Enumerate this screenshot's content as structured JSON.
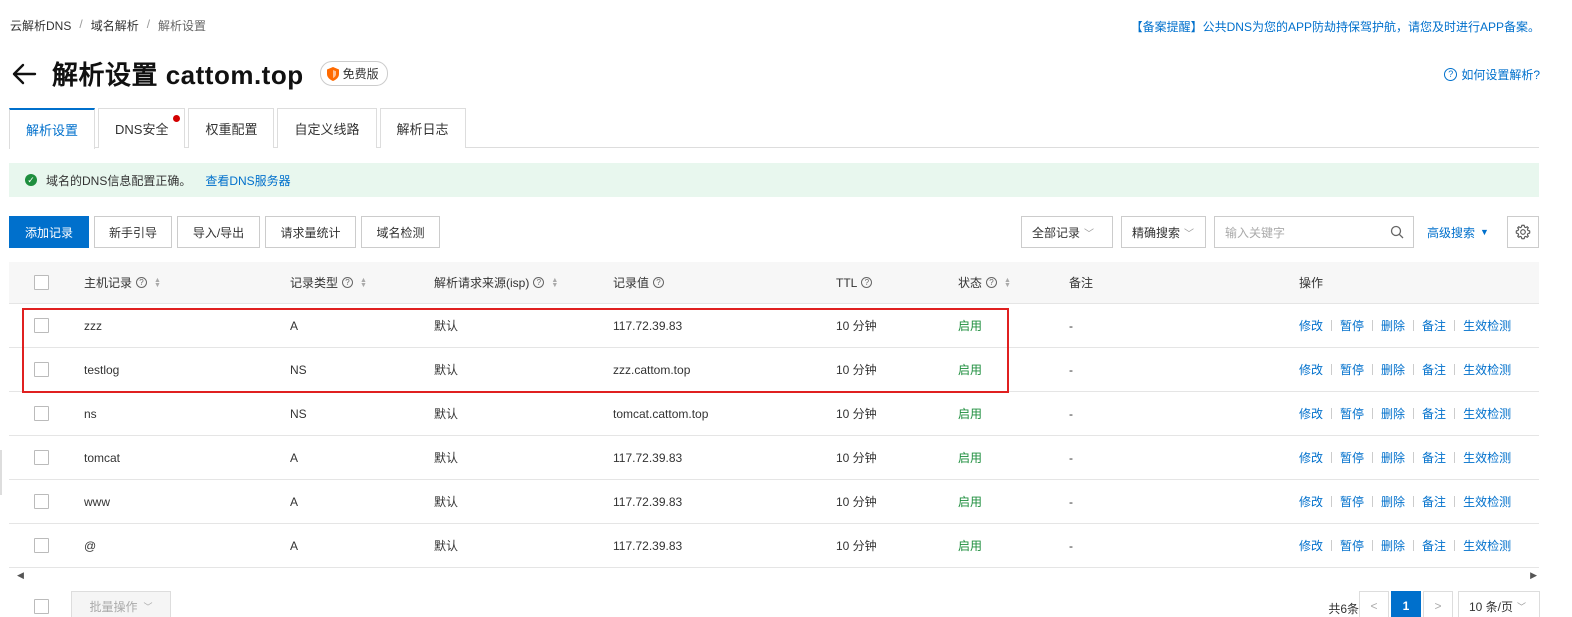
{
  "breadcrumb": [
    "云解析DNS",
    "域名解析",
    "解析设置"
  ],
  "breadcrumb_sep": "/",
  "notice": "【备案提醒】公共DNS为您的APP防劫持保驾护航，请您及时进行APP备案。",
  "header": {
    "title": "解析设置 cattom.top",
    "plan_badge": "免费版",
    "help_link": "如何设置解析?",
    "help_icon_text": "?"
  },
  "tabs": [
    {
      "label": "解析设置",
      "active": true
    },
    {
      "label": "DNS安全",
      "active": false,
      "has_dot": true
    },
    {
      "label": "权重配置",
      "active": false
    },
    {
      "label": "自定义线路",
      "active": false
    },
    {
      "label": "解析日志",
      "active": false
    }
  ],
  "alert": {
    "message": "域名的DNS信息配置正确。",
    "link": "查看DNS服务器",
    "icon_glyph": "✓"
  },
  "toolbar": {
    "add": "添加记录",
    "guide": "新手引导",
    "import_export": "导入/导出",
    "stats": "请求量统计",
    "check": "域名检测",
    "filter_all": "全部记录",
    "search_mode": "精确搜索",
    "search_placeholder": "输入关键字",
    "advanced": "高级搜索"
  },
  "table": {
    "columns": [
      "主机记录",
      "记录类型",
      "解析请求来源(isp)",
      "记录值",
      "TTL",
      "状态",
      "备注",
      "操作"
    ],
    "rows": [
      {
        "host": "zzz",
        "type": "A",
        "isp": "默认",
        "value": "117.72.39.83",
        "ttl": "10 分钟",
        "status": "启用",
        "remark": "-"
      },
      {
        "host": "testlog",
        "type": "NS",
        "isp": "默认",
        "value": "zzz.cattom.top",
        "ttl": "10 分钟",
        "status": "启用",
        "remark": "-"
      },
      {
        "host": "ns",
        "type": "NS",
        "isp": "默认",
        "value": "tomcat.cattom.top",
        "ttl": "10 分钟",
        "status": "启用",
        "remark": "-"
      },
      {
        "host": "tomcat",
        "type": "A",
        "isp": "默认",
        "value": "117.72.39.83",
        "ttl": "10 分钟",
        "status": "启用",
        "remark": "-"
      },
      {
        "host": "www",
        "type": "A",
        "isp": "默认",
        "value": "117.72.39.83",
        "ttl": "10 分钟",
        "status": "启用",
        "remark": "-"
      },
      {
        "host": "@",
        "type": "A",
        "isp": "默认",
        "value": "117.72.39.83",
        "ttl": "10 分钟",
        "status": "启用",
        "remark": "-"
      }
    ],
    "actions": [
      "修改",
      "暂停",
      "删除",
      "备注",
      "生效检测"
    ]
  },
  "footer": {
    "batch": "批量操作",
    "total": "共6条",
    "prev": "<",
    "current_page": "1",
    "next": ">",
    "page_size": "10 条/页"
  },
  "colors": {
    "accent": "#0070cc",
    "success": "#1e8e3e",
    "highlight": "#e02020"
  }
}
